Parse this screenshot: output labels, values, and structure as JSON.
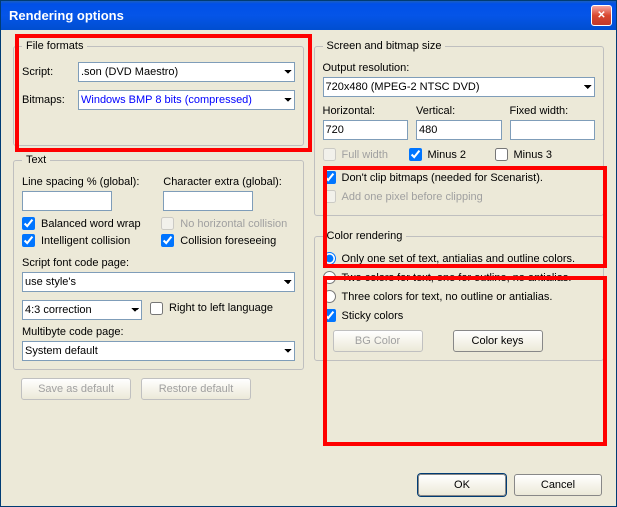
{
  "window": {
    "title": "Rendering options"
  },
  "file_formats": {
    "legend": "File formats",
    "script_label": "Script:",
    "script_value": ".son (DVD Maestro)",
    "bitmaps_label": "Bitmaps:",
    "bitmaps_value": "Windows BMP 8 bits (compressed)"
  },
  "text": {
    "legend": "Text",
    "line_spacing_label": "Line spacing % (global):",
    "line_spacing_value": "",
    "char_extra_label": "Character extra (global):",
    "char_extra_value": "",
    "balanced_word_wrap": "Balanced word wrap",
    "no_horizontal_collision": "No horizontal collision",
    "intelligent_collision": "Intelligent collision",
    "collision_foreseeing": "Collision foreseeing",
    "script_font_label": "Script font code page:",
    "script_font_value": "use style's",
    "correction_value": "4:3 correction",
    "right_to_left": "Right to left language",
    "multibyte_label": "Multibyte code page:",
    "multibyte_value": "System default"
  },
  "screen": {
    "legend": "Screen and bitmap size",
    "output_res_label": "Output resolution:",
    "output_res_value": "720x480 (MPEG-2 NTSC DVD)",
    "horizontal_label": "Horizontal:",
    "horizontal_value": "720",
    "vertical_label": "Vertical:",
    "vertical_value": "480",
    "fixed_width_label": "Fixed width:",
    "fixed_width_value": "",
    "full_width": "Full width",
    "minus2": "Minus 2",
    "minus3": "Minus 3",
    "dont_clip": "Don't clip bitmaps (needed for Scenarist).",
    "add_pixel": "Add one pixel before clipping"
  },
  "color": {
    "legend": "Color rendering",
    "opt1": "Only one set of text, antialias and outline colors.",
    "opt2": "Two colors for text, one for outline, no antialias.",
    "opt3": "Three colors for text, no outline or antialias.",
    "sticky": "Sticky colors",
    "bg_color": "BG Color",
    "color_keys": "Color keys"
  },
  "buttons": {
    "save_default": "Save as default",
    "restore_default": "Restore default",
    "ok": "OK",
    "cancel": "Cancel"
  }
}
